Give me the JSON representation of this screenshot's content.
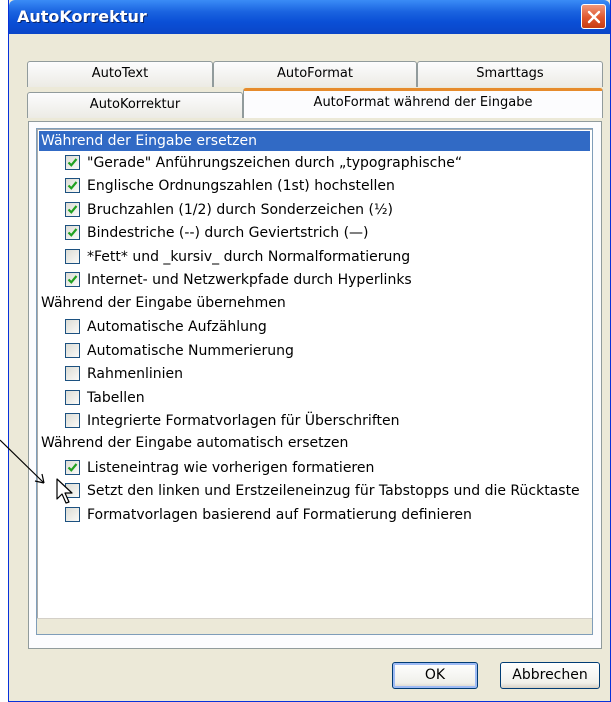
{
  "window": {
    "title": "AutoKorrektur"
  },
  "tabs": {
    "row_back": [
      "AutoText",
      "AutoFormat",
      "Smarttags"
    ],
    "row_front": [
      "AutoKorrektur",
      "AutoFormat während der Eingabe"
    ],
    "active": "AutoFormat während der Eingabe"
  },
  "sections": [
    {
      "header": "Während der Eingabe ersetzen",
      "options": [
        {
          "label": "\"Gerade\" Anführungszeichen durch „typographische“",
          "checked": true
        },
        {
          "label": "Englische Ordnungszahlen (1st) hochstellen",
          "checked": true
        },
        {
          "label": "Bruchzahlen (1/2) durch Sonderzeichen (½)",
          "checked": true
        },
        {
          "label": "Bindestriche (--) durch Geviertstrich (—)",
          "checked": true
        },
        {
          "label": "*Fett* und _kursiv_ durch Normalformatierung",
          "checked": false
        },
        {
          "label": "Internet- und Netzwerkpfade durch Hyperlinks",
          "checked": true
        }
      ]
    },
    {
      "header": "Während der Eingabe übernehmen",
      "options": [
        {
          "label": "Automatische Aufzählung",
          "checked": false
        },
        {
          "label": "Automatische Nummerierung",
          "checked": false
        },
        {
          "label": "Rahmenlinien",
          "checked": false
        },
        {
          "label": "Tabellen",
          "checked": false
        },
        {
          "label": "Integrierte Formatvorlagen für Überschriften",
          "checked": false
        }
      ]
    },
    {
      "header": "Während der Eingabe automatisch ersetzen",
      "options": [
        {
          "label": "Listeneintrag wie vorherigen formatieren",
          "checked": true
        },
        {
          "label": "Setzt den linken und Erstzeileneinzug für Tabstopps und die Rücktaste",
          "checked": false
        },
        {
          "label": "Formatvorlagen basierend auf Formatierung definieren",
          "checked": false
        }
      ]
    }
  ],
  "buttons": {
    "ok": "OK",
    "cancel": "Abbrechen"
  },
  "colors": {
    "selection": "#316ac5",
    "titlebar": "#0a4fd6",
    "active_tab_accent": "#e68b2c",
    "check": "#21a121"
  }
}
